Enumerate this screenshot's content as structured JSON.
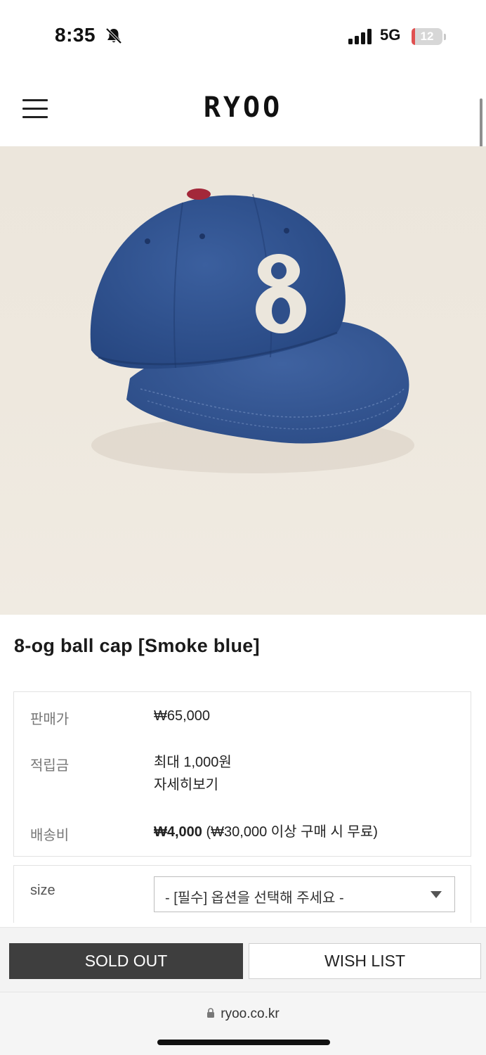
{
  "status": {
    "time": "8:35",
    "network": "5G",
    "battery": "12",
    "battery_level": 0.12
  },
  "header": {
    "logo": "RYOO"
  },
  "product": {
    "image_icon": "cap-photo",
    "title": "8-og ball cap [Smoke blue]",
    "colors": {
      "cap": "#2f4f8a",
      "button": "#a3283a",
      "patch": "#ebe6dc"
    }
  },
  "info": {
    "price_label": "판매가",
    "price_value": "₩65,000",
    "points_label": "적립금",
    "points_value": "최대 1,000원",
    "points_detail": "자세히보기",
    "shipping_label": "배송비",
    "shipping_fee": "₩4,000",
    "shipping_note": "(₩30,000 이상 구매 시 무료)"
  },
  "option": {
    "label": "size",
    "placeholder": "- [필수] 옵션을 선택해 주세요 -"
  },
  "actions": {
    "soldout_label": "SOLD OUT",
    "wishlist_label": "WISH LIST"
  },
  "browser": {
    "url": "ryoo.co.kr"
  }
}
